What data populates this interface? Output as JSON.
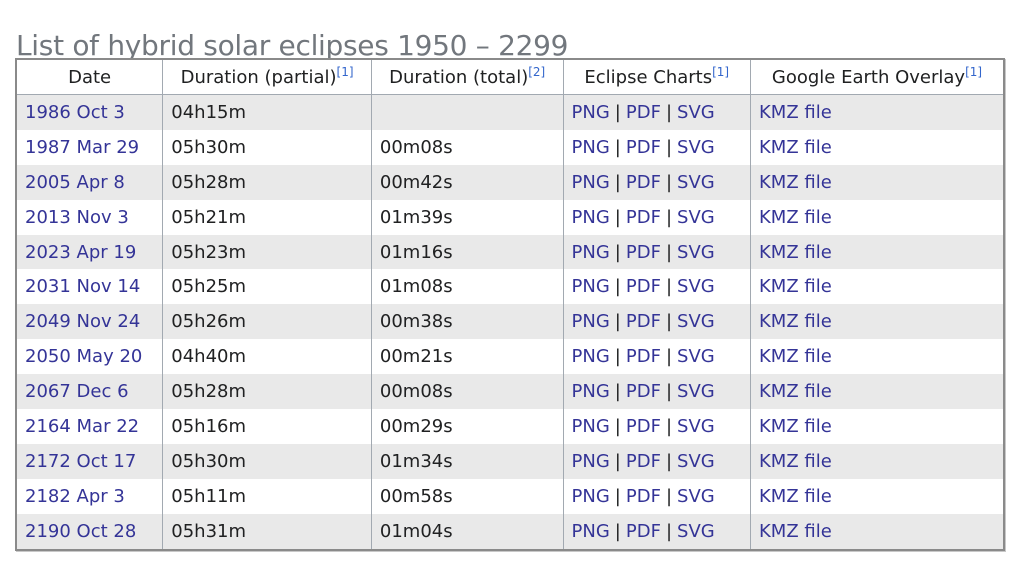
{
  "title": "List of hybrid solar eclipses 1950 – 2299",
  "headers": [
    {
      "label": "Date",
      "ref": ""
    },
    {
      "label": "Duration (partial)",
      "ref": "[1]"
    },
    {
      "label": "Duration (total)",
      "ref": "[2]"
    },
    {
      "label": "Eclipse Charts",
      "ref": "[1]"
    },
    {
      "label": "Google Earth Overlay",
      "ref": "[1]"
    }
  ],
  "chart_links": {
    "png": "PNG",
    "pdf": "PDF",
    "svg": "SVG",
    "separator": "|"
  },
  "kmz_label": "KMZ file",
  "rows": [
    {
      "date": "1986 Oct 3",
      "partial": "04h15m",
      "total": ""
    },
    {
      "date": "1987 Mar 29",
      "partial": "05h30m",
      "total": "00m08s"
    },
    {
      "date": "2005 Apr 8",
      "partial": "05h28m",
      "total": "00m42s"
    },
    {
      "date": "2013 Nov 3",
      "partial": "05h21m",
      "total": "01m39s"
    },
    {
      "date": "2023 Apr 19",
      "partial": "05h23m",
      "total": "01m16s"
    },
    {
      "date": "2031 Nov 14",
      "partial": "05h25m",
      "total": "01m08s"
    },
    {
      "date": "2049 Nov 24",
      "partial": "05h26m",
      "total": "00m38s"
    },
    {
      "date": "2050 May 20",
      "partial": "04h40m",
      "total": "00m21s"
    },
    {
      "date": "2067 Dec 6",
      "partial": "05h28m",
      "total": "00m08s"
    },
    {
      "date": "2164 Mar 22",
      "partial": "05h16m",
      "total": "00m29s"
    },
    {
      "date": "2172 Oct 17",
      "partial": "05h30m",
      "total": "01m34s"
    },
    {
      "date": "2182 Apr 3",
      "partial": "05h11m",
      "total": "00m58s"
    },
    {
      "date": "2190 Oct 28",
      "partial": "05h31m",
      "total": "01m04s"
    }
  ]
}
